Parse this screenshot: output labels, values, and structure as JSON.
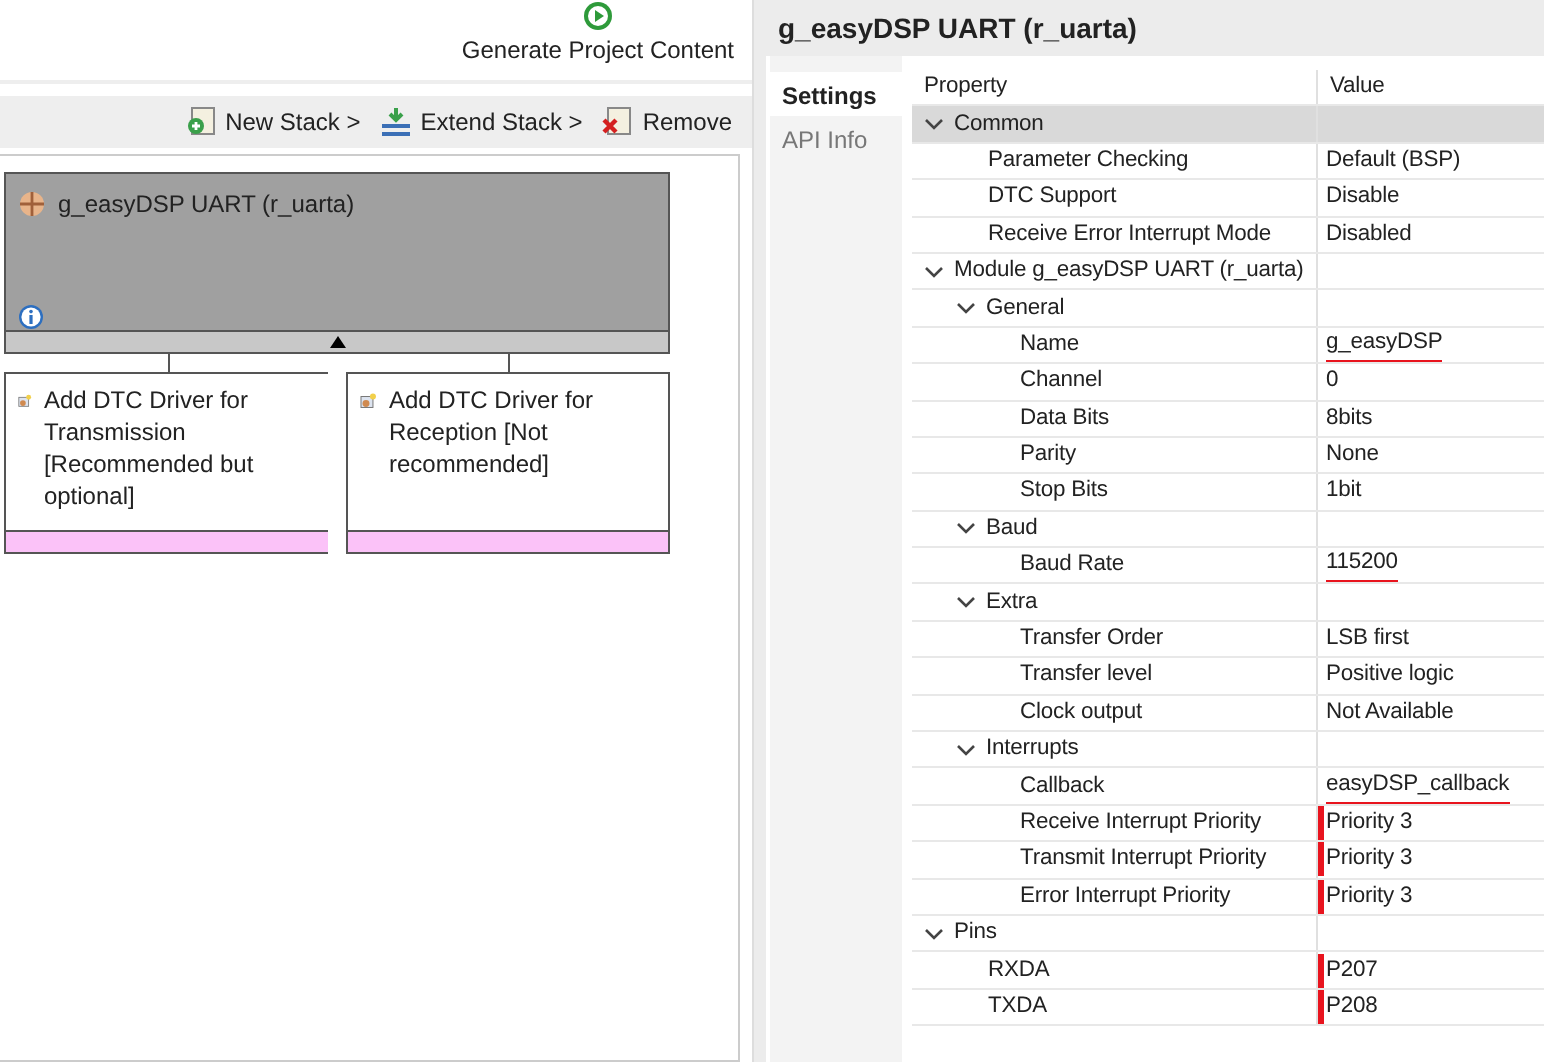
{
  "generate": {
    "label": "Generate Project Content"
  },
  "toolbar": [
    {
      "kind": "new",
      "label": "New Stack >"
    },
    {
      "kind": "extend",
      "label": "Extend Stack >"
    },
    {
      "kind": "remove",
      "label": "Remove"
    }
  ],
  "stack": {
    "title": "g_easyDSP UART (r_uarta)",
    "children": [
      {
        "label": "Add DTC Driver for Transmission [Recommended but optional]"
      },
      {
        "label": "Add DTC Driver for Reception [Not recommended]"
      }
    ]
  },
  "panel": {
    "title": "g_easyDSP UART (r_uarta)",
    "tabs": [
      {
        "label": "Settings",
        "selected": true
      },
      {
        "label": "API Info",
        "selected": false
      }
    ],
    "columns": [
      "Property",
      "Value"
    ],
    "rows": [
      {
        "property": "Common",
        "expanded": true,
        "selected": true,
        "children": [
          {
            "property": "Parameter Checking",
            "value": "Default (BSP)",
            "underlined": false,
            "flagged": false
          },
          {
            "property": "DTC Support",
            "value": "Disable",
            "underlined": false,
            "flagged": false
          },
          {
            "property": "Receive Error Interrupt Mode",
            "value": "Disabled",
            "underlined": false,
            "flagged": false
          }
        ]
      },
      {
        "property": "Module g_easyDSP UART (r_uarta)",
        "expanded": true,
        "selected": false,
        "children": [
          {
            "property": "General",
            "expanded": true,
            "selected": false,
            "children": [
              {
                "property": "Name",
                "value": "g_easyDSP",
                "underlined": true,
                "flagged": false
              },
              {
                "property": "Channel",
                "value": "0",
                "underlined": false,
                "flagged": false
              },
              {
                "property": "Data Bits",
                "value": "8bits",
                "underlined": false,
                "flagged": false
              },
              {
                "property": "Parity",
                "value": "None",
                "underlined": false,
                "flagged": false
              },
              {
                "property": "Stop Bits",
                "value": "1bit",
                "underlined": false,
                "flagged": false
              }
            ]
          },
          {
            "property": "Baud",
            "expanded": true,
            "selected": false,
            "children": [
              {
                "property": "Baud Rate",
                "value": "115200",
                "underlined": true,
                "flagged": false
              }
            ]
          },
          {
            "property": "Extra",
            "expanded": true,
            "selected": false,
            "children": [
              {
                "property": "Transfer Order",
                "value": "LSB first",
                "underlined": false,
                "flagged": false
              },
              {
                "property": "Transfer level",
                "value": "Positive logic",
                "underlined": false,
                "flagged": false
              },
              {
                "property": "Clock output",
                "value": "Not Available",
                "underlined": false,
                "flagged": false
              }
            ]
          },
          {
            "property": "Interrupts",
            "expanded": true,
            "selected": false,
            "children": [
              {
                "property": "Callback",
                "value": "easyDSP_callback",
                "underlined": true,
                "flagged": false
              },
              {
                "property": "Receive Interrupt Priority",
                "value": "Priority 3",
                "underlined": false,
                "flagged": true
              },
              {
                "property": "Transmit Interrupt Priority",
                "value": "Priority 3",
                "underlined": false,
                "flagged": true
              },
              {
                "property": "Error Interrupt Priority",
                "value": "Priority 3",
                "underlined": false,
                "flagged": true
              }
            ]
          }
        ]
      },
      {
        "property": "Pins",
        "expanded": true,
        "selected": false,
        "children": [
          {
            "property": "RXDA",
            "value": "P207",
            "underlined": false,
            "flagged": true
          },
          {
            "property": "TXDA",
            "value": "P208",
            "underlined": false,
            "flagged": true
          }
        ]
      }
    ]
  }
}
